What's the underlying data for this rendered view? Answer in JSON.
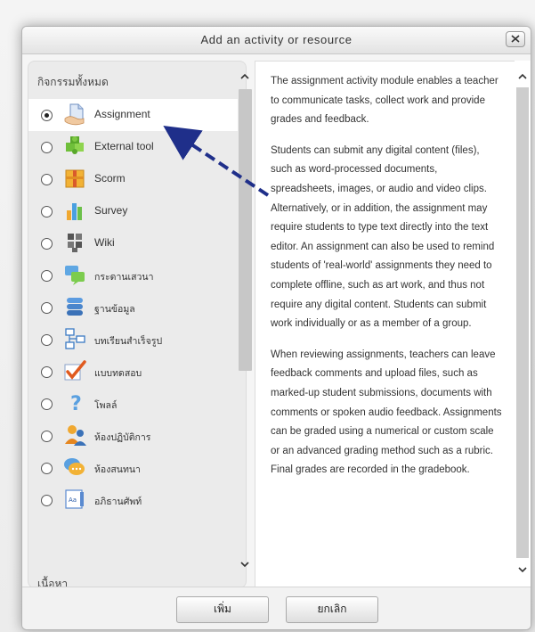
{
  "dialog": {
    "title": "Add an activity or resource",
    "close_label": "x"
  },
  "activities": {
    "header": "กิจกรรมทั้งหมด",
    "items": [
      {
        "label": "Assignment",
        "icon": "assignment-icon",
        "selected": true
      },
      {
        "label": "External tool",
        "icon": "puzzle-icon",
        "selected": false
      },
      {
        "label": "Scorm",
        "icon": "scorm-package-icon",
        "selected": false
      },
      {
        "label": "Survey",
        "icon": "bar-chart-icon",
        "selected": false
      },
      {
        "label": "Wiki",
        "icon": "wiki-icon",
        "selected": false
      },
      {
        "label": "กระดานเสวนา",
        "icon": "forum-icon",
        "selected": false
      },
      {
        "label": "ฐานข้อมูล",
        "icon": "database-icon",
        "selected": false
      },
      {
        "label": "บทเรียนสำเร็จรูป",
        "icon": "lesson-icon",
        "selected": false
      },
      {
        "label": "แบบทดสอบ",
        "icon": "quiz-checkmark-icon",
        "selected": false
      },
      {
        "label": "โพลล์",
        "icon": "question-mark-icon",
        "selected": false
      },
      {
        "label": "ห้องปฏิบัติการ",
        "icon": "workshop-icon",
        "selected": false
      },
      {
        "label": "ห้องสนทนา",
        "icon": "chat-icon",
        "selected": false
      },
      {
        "label": "อภิธานศัพท์",
        "icon": "glossary-icon",
        "selected": false
      }
    ],
    "next_section_header": "เนื้อหา"
  },
  "description": {
    "paragraphs": [
      "The assignment activity module enables a teacher to communicate tasks, collect work and provide grades and feedback.",
      "Students can submit any digital content (files), such as word-processed documents, spreadsheets, images, or audio and video clips. Alternatively, or in addition, the assignment may require students to type text directly into the text editor. An assignment can also be used to remind students of 'real-world' assignments they need to complete offline, such as art work, and thus not require any digital content. Students can submit work individually or as a member of a group.",
      "When reviewing assignments, teachers can leave feedback comments and upload files, such as marked-up student submissions, documents with comments or spoken audio feedback. Assignments can be graded using a numerical or custom scale or an advanced grading method such as a rubric. Final grades are recorded in the gradebook."
    ]
  },
  "footer": {
    "add_label": "เพิ่ม",
    "cancel_label": "ยกเลิก"
  },
  "colors": {
    "arrow": "#1f2f8a",
    "selected_row": "#ffffff",
    "panel_bg": "#ebebeb"
  }
}
